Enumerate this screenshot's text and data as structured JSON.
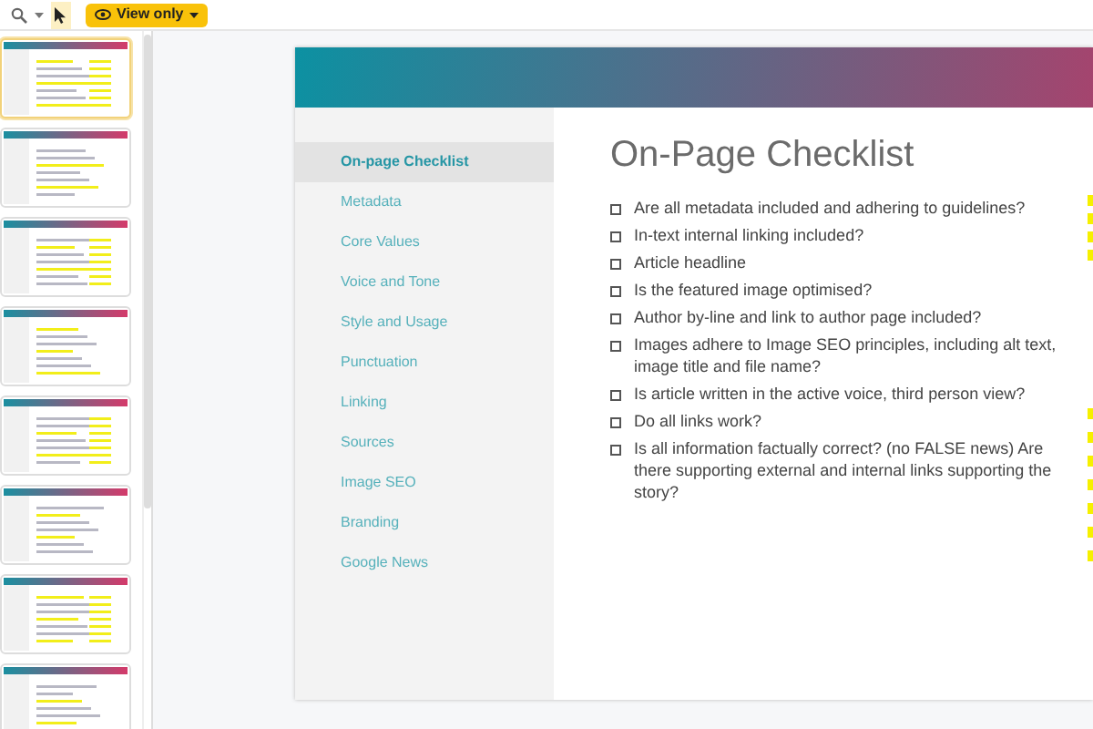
{
  "toolbar": {
    "pointer_selected": true,
    "mode_button": "View only"
  },
  "thumbnails": [
    {
      "selected": true
    },
    {
      "selected": false
    },
    {
      "selected": false
    },
    {
      "selected": false
    },
    {
      "selected": false
    },
    {
      "selected": false
    },
    {
      "selected": false
    },
    {
      "selected": false
    }
  ],
  "slide": {
    "nav": [
      {
        "label": "On-page Checklist",
        "selected": true
      },
      {
        "label": "Metadata",
        "selected": false
      },
      {
        "label": "Core Values",
        "selected": false
      },
      {
        "label": "Voice and Tone",
        "selected": false
      },
      {
        "label": "Style and Usage",
        "selected": false
      },
      {
        "label": "Punctuation",
        "selected": false
      },
      {
        "label": "Linking",
        "selected": false
      },
      {
        "label": "Sources",
        "selected": false
      },
      {
        "label": "Image SEO",
        "selected": false
      },
      {
        "label": "Branding",
        "selected": false
      },
      {
        "label": "Google News",
        "selected": false
      }
    ],
    "title": "On-Page Checklist",
    "checklist": [
      {
        "text": "Are all metadata included and adhering to guidelines?",
        "checked": false
      },
      {
        "text": "In-text internal linking included?",
        "checked": false
      },
      {
        "text": "Article headline",
        "checked": false
      },
      {
        "text": "Is the featured image optimised?",
        "checked": false
      },
      {
        "text": "Author by-line and link to author page included?",
        "checked": false
      },
      {
        "text": "Images adhere to Image SEO principles, including alt text, image title and file name?",
        "checked": false
      },
      {
        "text": "Is article written in the active voice, third person view?",
        "checked": false
      },
      {
        "text": "Do all links work?",
        "checked": false
      },
      {
        "text": "Is all information factually correct? (no FALSE news) Are there supporting external and internal links supporting the story?",
        "checked": false
      }
    ]
  }
}
